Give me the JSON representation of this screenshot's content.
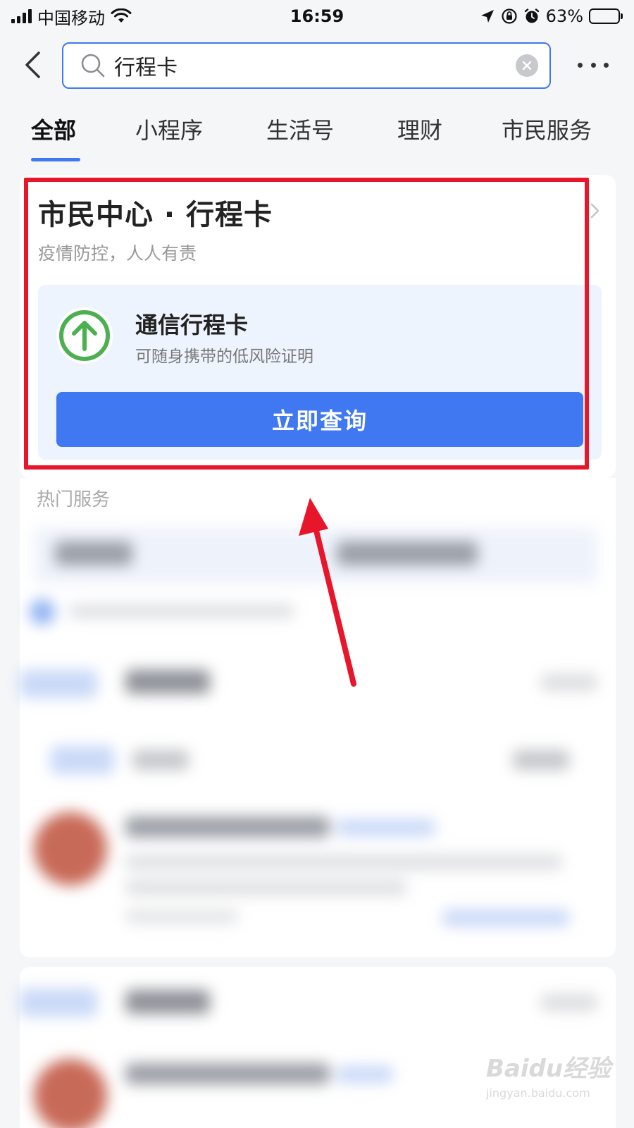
{
  "status_bar": {
    "carrier": "中国移动",
    "time": "16:59",
    "battery_percent_text": "63%",
    "battery_level": 0.63
  },
  "search": {
    "query": "行程卡",
    "placeholder": ""
  },
  "tabs": [
    {
      "label": "全部",
      "active": true
    },
    {
      "label": "小程序",
      "active": false
    },
    {
      "label": "生活号",
      "active": false
    },
    {
      "label": "理财",
      "active": false
    },
    {
      "label": "市民服务",
      "active": false
    }
  ],
  "card": {
    "title": "市民中心 · 行程卡",
    "subtitle": "疫情防控，人人有责",
    "service": {
      "name": "通信行程卡",
      "description": "可随身携带的低风险证明",
      "icon": "arrow-up-circle-icon"
    },
    "action_label": "立即查询"
  },
  "hot_services_label": "热门服务",
  "watermark": {
    "logo": "Baidu经验",
    "url": "jingyan.baidu.com"
  },
  "colors": {
    "accent": "#3f78f0",
    "highlight": "#e8162a",
    "icon_green": "#4caf50",
    "panel_bg": "#eef4fd"
  }
}
